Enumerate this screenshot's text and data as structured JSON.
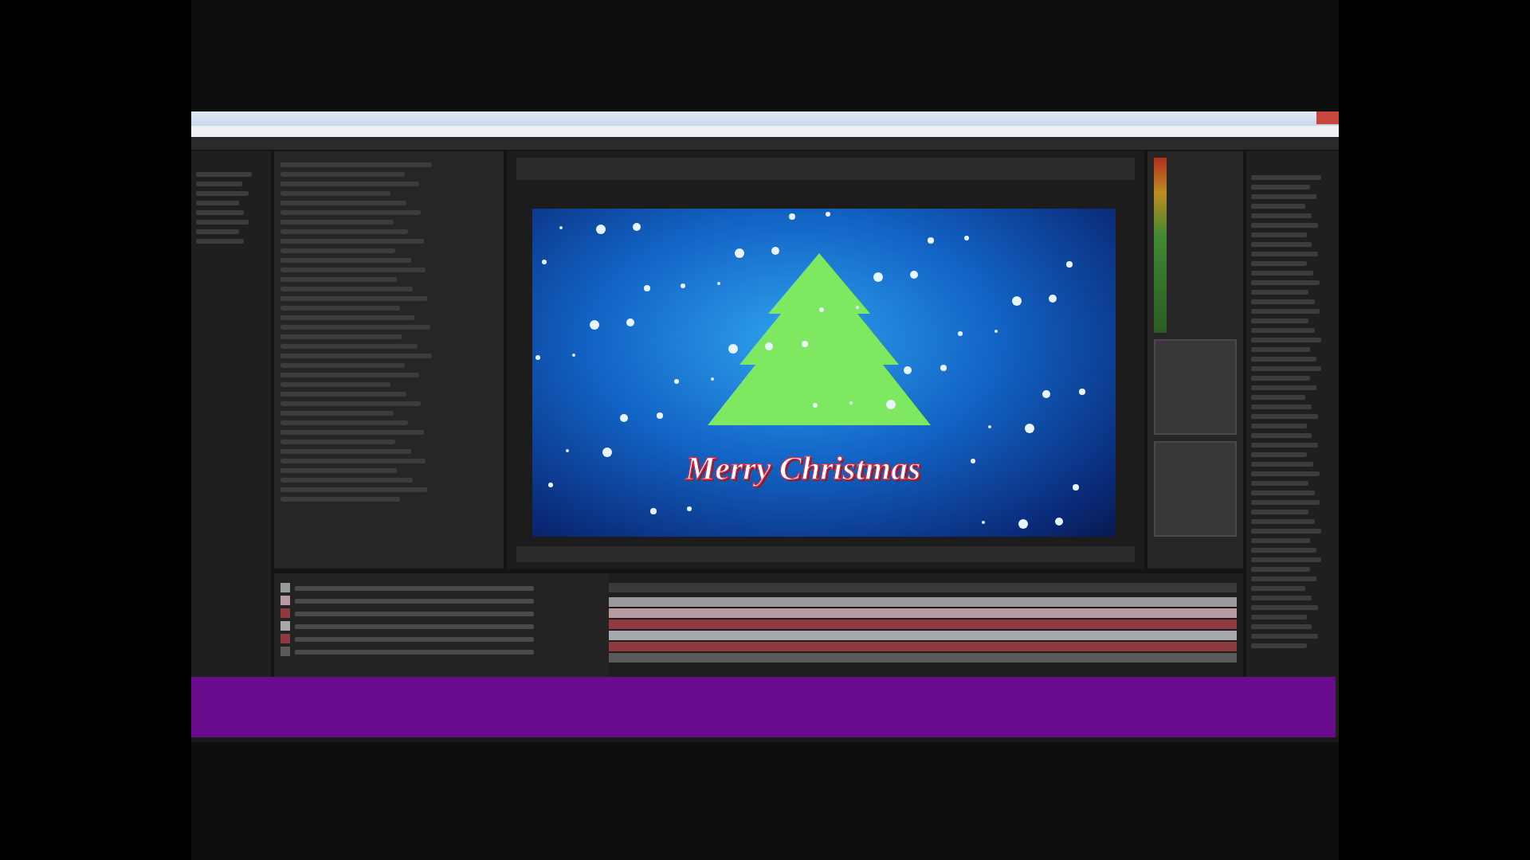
{
  "composition": {
    "caption": "Merry Christmas"
  },
  "timeline": {
    "tracks": [
      {
        "color": "#9a9a9e"
      },
      {
        "color": "#b89aa0"
      },
      {
        "color": "#8e3a40"
      },
      {
        "color": "#a8a8ac"
      },
      {
        "color": "#8e3a40"
      },
      {
        "color": "#5a5a5a"
      }
    ]
  }
}
